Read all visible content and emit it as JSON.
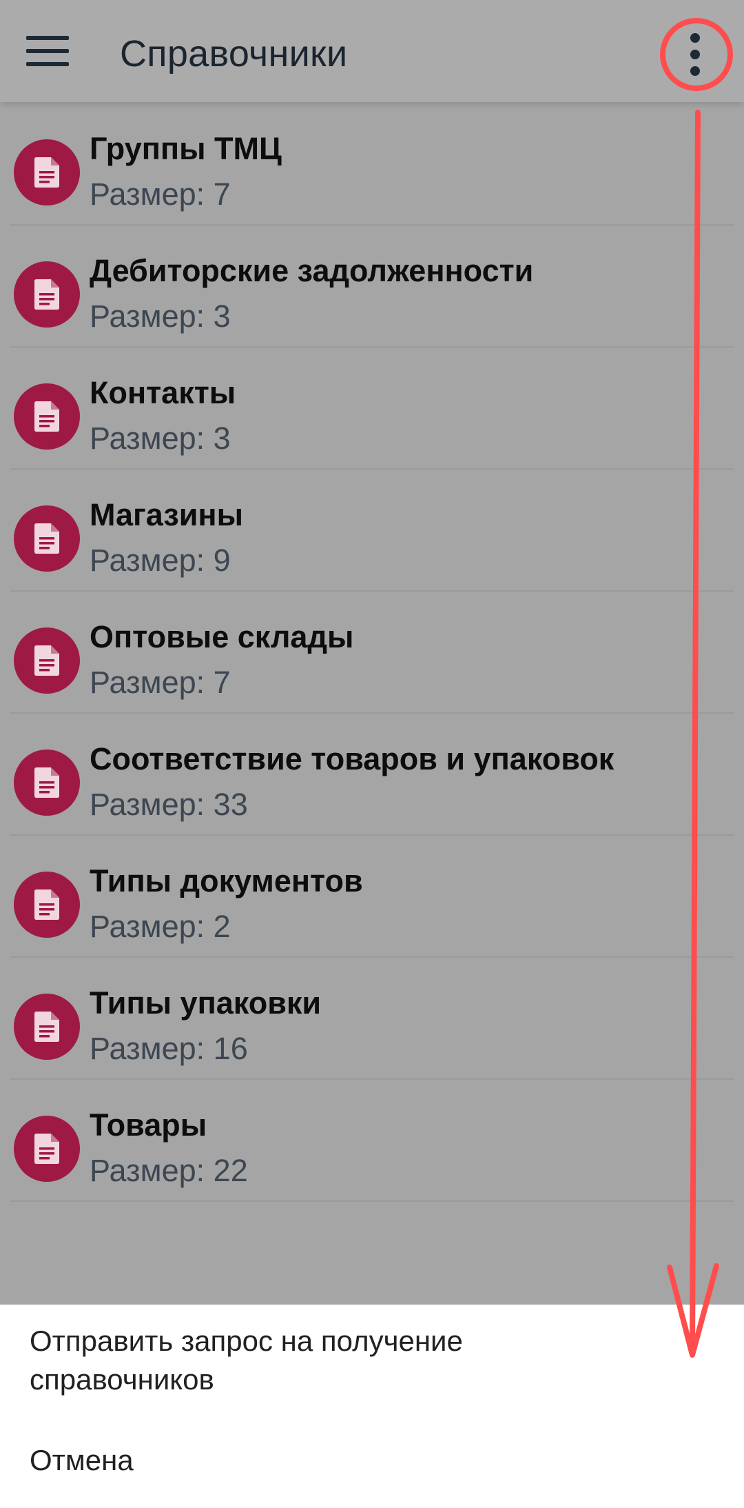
{
  "appbar": {
    "title": "Справочники",
    "menu_icon": "hamburger-menu-icon",
    "more_icon": "more-vertical-icon"
  },
  "list": {
    "items": [
      {
        "title": "Группы ТМЦ",
        "subtitle": "Размер: 7",
        "icon": "document-icon"
      },
      {
        "title": "Дебиторские задолженности",
        "subtitle": "Размер: 3",
        "icon": "document-icon"
      },
      {
        "title": "Контакты",
        "subtitle": "Размер: 3",
        "icon": "document-icon"
      },
      {
        "title": "Магазины",
        "subtitle": "Размер: 9",
        "icon": "document-icon"
      },
      {
        "title": "Оптовые склады",
        "subtitle": "Размер: 7",
        "icon": "document-icon"
      },
      {
        "title": "Соответствие  товаров и упаковок",
        "subtitle": "Размер: 33",
        "icon": "document-icon"
      },
      {
        "title": "Типы документов",
        "subtitle": "Размер: 2",
        "icon": "document-icon"
      },
      {
        "title": "Типы упаковки",
        "subtitle": "Размер: 16",
        "icon": "document-icon"
      },
      {
        "title": "Товары",
        "subtitle": "Размер: 22",
        "icon": "document-icon"
      }
    ]
  },
  "bottom_sheet": {
    "items": [
      {
        "label": "Отправить запрос на получение справочников"
      },
      {
        "label": "Отмена"
      }
    ]
  },
  "colors": {
    "scrim_background": "#a5a5a5",
    "appbar_background": "#ababab",
    "avatar": "#9e1a45",
    "annotation": "#ff4d4d",
    "sheet_background": "#ffffff"
  }
}
